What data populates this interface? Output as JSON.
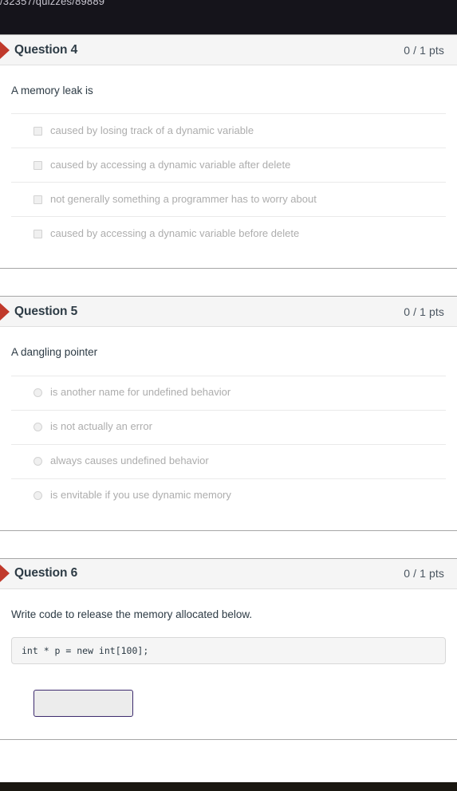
{
  "browser": {
    "url_fragment": "/32357/quizzes/89889"
  },
  "colors": {
    "flag_red": "#c0392b",
    "header_bg": "#f5f5f5",
    "text_dark": "#2d3b45",
    "answer_gray": "#adadad",
    "input_border": "#3d2b6e",
    "chrome_dark": "#15141b"
  },
  "questions": [
    {
      "name": "Question 4",
      "points": "0 / 1 pts",
      "prompt": "A memory leak is",
      "control_type": "checkbox",
      "options": [
        {
          "label": "caused by losing track of a dynamic variable"
        },
        {
          "label": "caused by accessing a dynamic variable after delete"
        },
        {
          "label": "not generally something a programmer has to worry about"
        },
        {
          "label": "caused by accessing a dynamic variable before delete"
        }
      ]
    },
    {
      "name": "Question 5",
      "points": "0 / 1 pts",
      "prompt": "A dangling pointer",
      "control_type": "radio",
      "options": [
        {
          "label": "is another name for undefined behavior"
        },
        {
          "label": "is not actually an error"
        },
        {
          "label": "always causes undefined behavior"
        },
        {
          "label": "is envitable if you use dynamic memory"
        }
      ]
    },
    {
      "name": "Question 6",
      "points": "0 / 1 pts",
      "prompt": "Write code to release the memory allocated below.",
      "control_type": "text",
      "code": "int * p = new int[100];",
      "answer_value": "",
      "answer_placeholder": ""
    }
  ]
}
